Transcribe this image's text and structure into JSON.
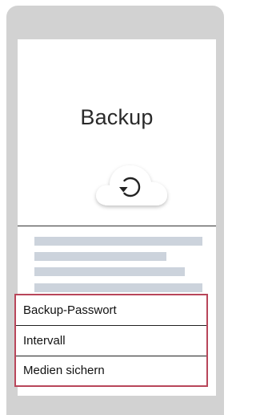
{
  "screen": {
    "title": "Backup",
    "icon": "cloud-sync-icon"
  },
  "settings": {
    "items": [
      {
        "label": "Backup-Passwort"
      },
      {
        "label": "Intervall"
      },
      {
        "label": "Medien sichern"
      }
    ]
  },
  "colors": {
    "frame": "#d2d2d2",
    "placeholder": "#ccd3dc",
    "highlight_border": "#b8465a",
    "divider": "#333333"
  }
}
